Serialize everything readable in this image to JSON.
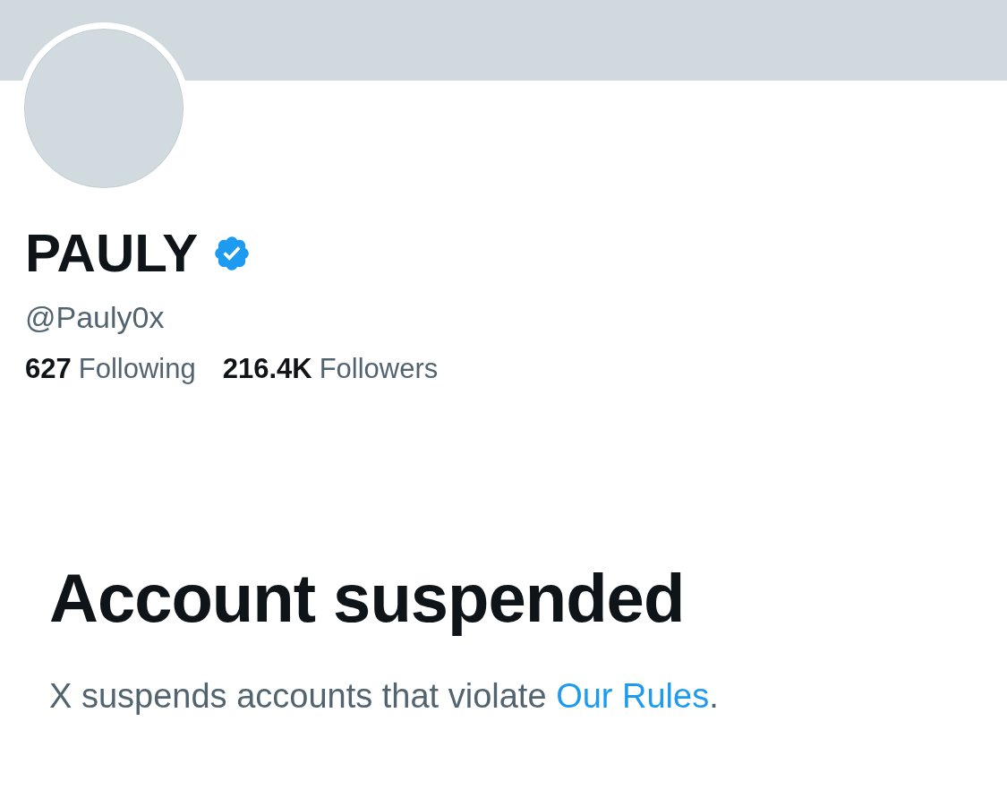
{
  "profile": {
    "name": "PAULY",
    "verified": true,
    "handle": "@Pauly0x",
    "stats": [
      {
        "count": "627",
        "label": "Following"
      },
      {
        "count": "216.4K",
        "label": "Followers"
      }
    ]
  },
  "notice": {
    "title": "Account suspended",
    "text_before": "X suspends accounts that violate ",
    "link": "Our Rules",
    "text_after": "."
  }
}
